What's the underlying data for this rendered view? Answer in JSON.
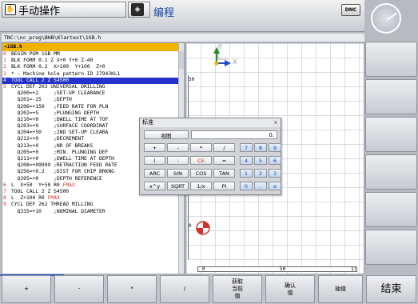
{
  "header": {
    "machine_mode_label": "手动操作",
    "program_mode_label": "编程",
    "dnc_label": "DNC"
  },
  "program": {
    "path": "TNC:\\nc_prog\\BHB\\Klartext\\1GB.h",
    "file_name": "→1GB.h",
    "lines": [
      {
        "num": "0",
        "text": "BEGIN PGM 1GB MM"
      },
      {
        "num": "1",
        "text": "BLK FORM 0.1 Z X+0 Y+0 Z-40"
      },
      {
        "num": "2",
        "text": "BLK FORM 0.2  X+100  Y+100  Z+0"
      },
      {
        "num": "3",
        "text": "* - Machine hole pattern ID 27943KL1"
      },
      {
        "num": "4",
        "text": "TOOL CALL 2 Z S4500"
      },
      {
        "num": "5",
        "text": "CYCL DEF 203 UNIVERSAL DRILLING"
      },
      {
        "num": "",
        "text": "  Q200=+2     ;SET-UP CLEARANCE"
      },
      {
        "num": "",
        "text": "  Q201=-25    ;DEPTH"
      },
      {
        "num": "",
        "text": "  Q206=+150   ;FEED RATE FOR PLN"
      },
      {
        "num": "",
        "text": "  Q202=+5     ;PLUNGING DEPTH"
      },
      {
        "num": "",
        "text": "  Q210=+0     ;DWELL TIME AT TOF"
      },
      {
        "num": "",
        "text": "  Q203=+0     ;SURFACE COORDINAT"
      },
      {
        "num": "",
        "text": "  Q204=+50    ;2ND SET-UP CLEARA"
      },
      {
        "num": "",
        "text": "  Q212=+0     ;DECREMENT"
      },
      {
        "num": "",
        "text": "  Q213=+0     ;NR OF BREAKS"
      },
      {
        "num": "",
        "text": "  Q205=+0     ;MIN. PLUNGING DEF"
      },
      {
        "num": "",
        "text": "  Q211=+0     ;DWELL TIME AT DEPTH"
      },
      {
        "num": "",
        "text": "  Q208=+99999 ;RETRACTION FEED RATE"
      },
      {
        "num": "",
        "text": "  Q256=+0.2   ;DIST FOR CHIP BRKNG"
      },
      {
        "num": "",
        "text": "  Q395=+0     ;DEPTH REFERENCE"
      },
      {
        "num": "6",
        "text": "L  X+50  Y+50 R0 ",
        "fmax": "FMAX"
      },
      {
        "num": "7",
        "text": "TOOL CALL 2 Z S4500"
      },
      {
        "num": "8",
        "text": "L  Z+100 R0 ",
        "fmax": "FMAX"
      },
      {
        "num": "9",
        "text": "CYCL DEF 262 THREAD MILLING"
      },
      {
        "num": "",
        "text": "  Q335=+10    ;NOMINAL DIAMETER"
      }
    ],
    "selected_index": 4
  },
  "graphic": {
    "y_label": "Y",
    "x_label": "X",
    "ruler_50": "50",
    "ruler_10": "1(",
    "ruler_0": "0",
    "vruler_0": "0",
    "vruler_50": "50"
  },
  "calculator": {
    "title": "标准",
    "close": "x",
    "view_label": "视图",
    "display": "0.",
    "rows": [
      [
        "+",
        "-",
        "*",
        "/",
        "7",
        "8",
        "9"
      ],
      [
        "(",
        ")",
        "CE",
        "=",
        "4",
        "5",
        "6"
      ],
      [
        "ARC",
        "SIN",
        "COS",
        "TAN",
        "1",
        "2",
        "3"
      ],
      [
        "x^y",
        "SQRT",
        "1/x",
        "PI",
        "0",
        ".",
        "±"
      ]
    ]
  },
  "softkeys": {
    "k1": "+",
    "k2": "-",
    "k3": "*",
    "k4": "/",
    "k5": "获取\n当前\n值",
    "k6": "确认\n值",
    "k7": "抽值",
    "k8": "结束"
  }
}
